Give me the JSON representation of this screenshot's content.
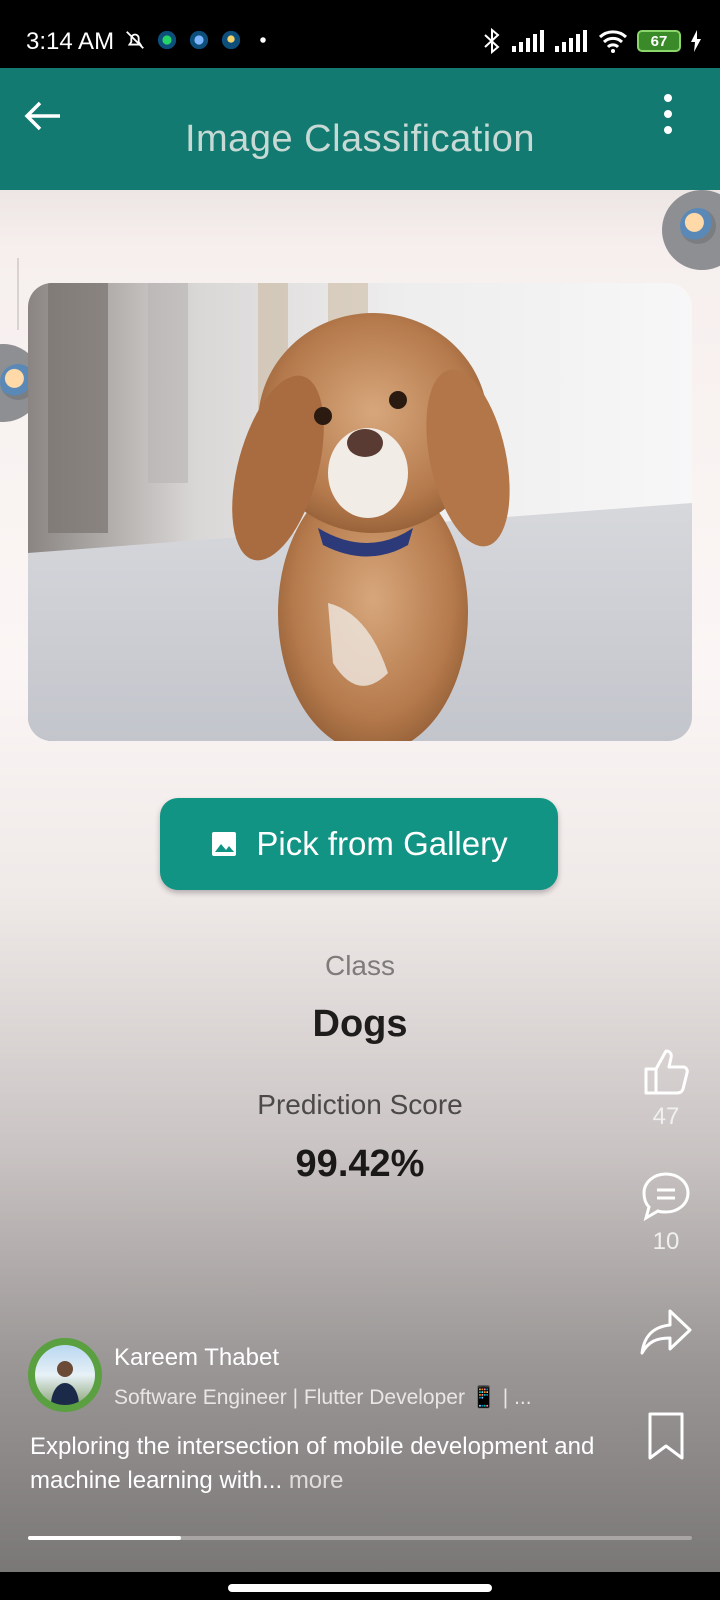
{
  "status_bar": {
    "time": "3:14 AM",
    "battery": "67",
    "left_icons": [
      "mute-bell-icon",
      "whatsapp-icon",
      "messenger-icon",
      "app-icon",
      "dot-icon"
    ],
    "right_icons": [
      "bluetooth-icon",
      "signal-icon",
      "signal-icon",
      "wifi-icon",
      "charging-icon"
    ]
  },
  "app": {
    "title": "Image Classification",
    "gallery_button": "Pick from Gallery",
    "class_label": "Class",
    "class_value": "Dogs",
    "score_label": "Prediction Score",
    "score_value": "99.42%",
    "accent": "#127a70",
    "button_color": "#129485"
  },
  "reel": {
    "likes": "47",
    "comments": "10",
    "author": "Kareem Thabet",
    "headline": "Software Engineer | Flutter Developer 📱 | ...",
    "caption": "Exploring the intersection of mobile development and machine learning with...",
    "more": "more",
    "progress": 0.23
  }
}
